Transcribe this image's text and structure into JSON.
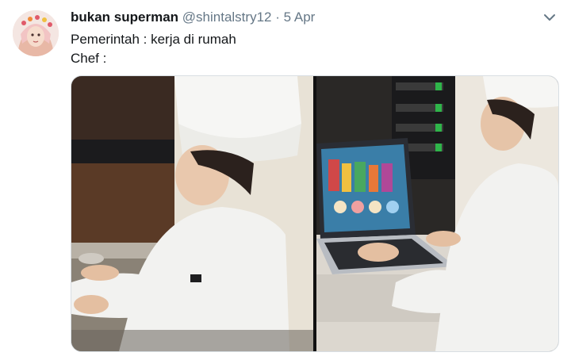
{
  "tweet": {
    "author_name": "bukan superman",
    "handle": "@shintalstry12",
    "separator": "·",
    "date": "5 Apr",
    "line1": "Pemerintah : kerja di rumah",
    "line2": "Chef :",
    "media": [
      {
        "alt": "photo-left"
      },
      {
        "alt": "photo-right"
      }
    ]
  },
  "icons": {
    "avatar": "avatar",
    "menu": "chevron-down-icon"
  }
}
